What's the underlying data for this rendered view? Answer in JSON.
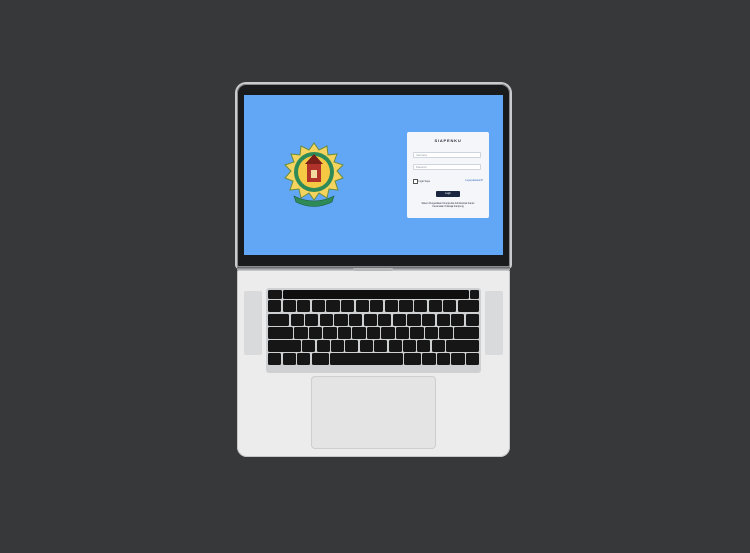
{
  "login": {
    "app_title": "SIAPENKU",
    "username_placeholder": "Username",
    "password_placeholder": "Password",
    "remember_label": "Ingat Saya",
    "forgot_label": "Lupa password?",
    "login_button": "Login",
    "footer_line1": "Sistem Pengelolaan Kinerja dan Administrasi Kantor",
    "footer_line2": "Kecamatan Kotaraja Kampung"
  },
  "colors": {
    "background": "#37383a",
    "screen": "#62a6f6",
    "button": "#1b2740"
  },
  "icons": {
    "logo": "regional-emblem-icon"
  }
}
